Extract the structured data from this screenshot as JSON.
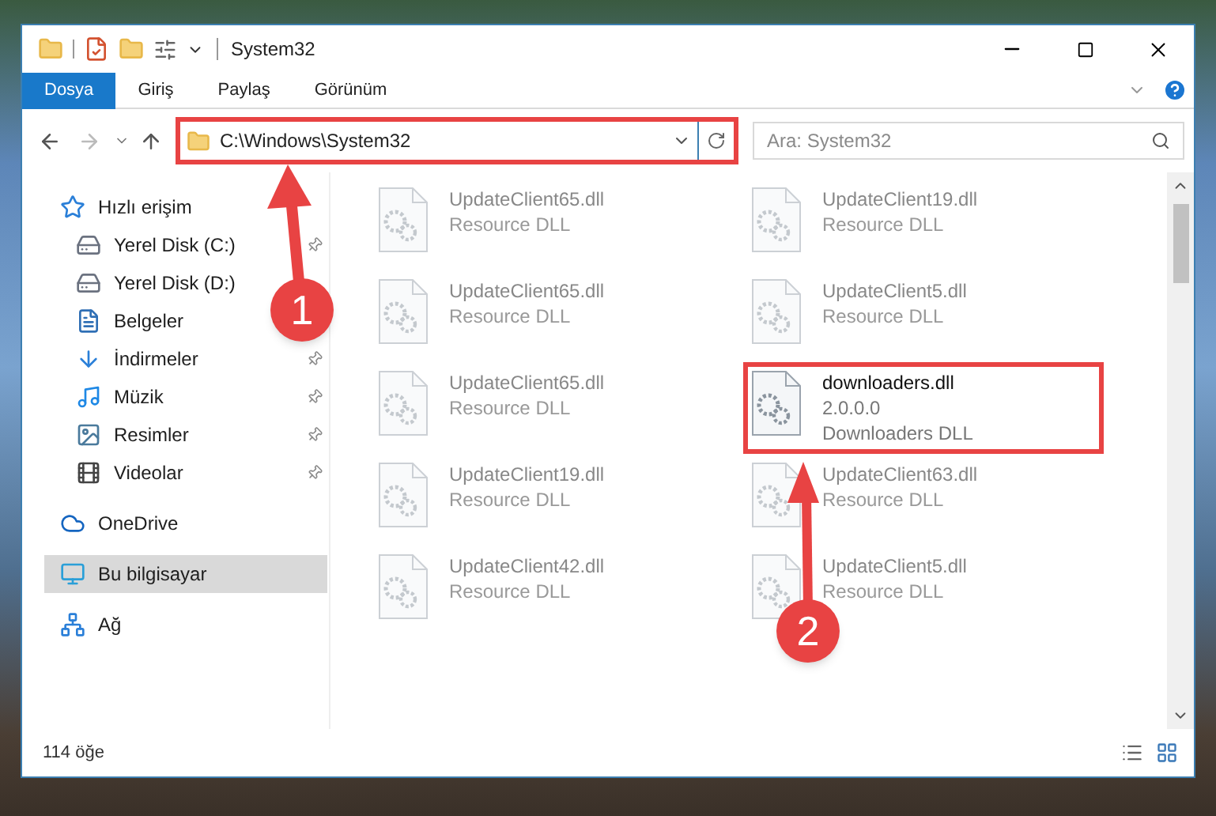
{
  "window": {
    "title": "System32"
  },
  "ribbon_tabs": [
    {
      "label": "Dosya",
      "selected": true
    },
    {
      "label": "Giriş",
      "selected": false
    },
    {
      "label": "Paylaş",
      "selected": false
    },
    {
      "label": "Görünüm",
      "selected": false
    }
  ],
  "address": {
    "path": "C:\\Windows\\System32",
    "annotated": true
  },
  "search": {
    "placeholder": "Ara: System32"
  },
  "sidebar": {
    "items": [
      {
        "label": "Hızlı erişim",
        "selected": false,
        "children": [
          {
            "label": "Yerel Disk (C:)",
            "pinned": true,
            "selected": false
          },
          {
            "label": "Yerel Disk (D:)",
            "selected": false
          },
          {
            "label": "Belgeler",
            "selected": false
          },
          {
            "label": "İndirmeler",
            "pinned": true,
            "selected": false
          },
          {
            "label": "Müzik",
            "pinned": true,
            "selected": false
          },
          {
            "label": "Resimler",
            "pinned": true,
            "selected": false
          },
          {
            "label": "Videolar",
            "pinned": true,
            "selected": false
          }
        ]
      },
      {
        "label": "OneDrive",
        "selected": false
      },
      {
        "label": "Bu bilgisayar",
        "selected": true
      },
      {
        "label": "Ağ",
        "selected": false
      }
    ]
  },
  "files": [
    {
      "name": "UpdateClient65.dll",
      "lines": [
        "Resource DLL"
      ],
      "blurred": true,
      "annotated": false
    },
    {
      "name": "UpdateClient19.dll",
      "lines": [
        "Resource DLL"
      ],
      "blurred": true,
      "annotated": false
    },
    {
      "name": "UpdateClient65.dll",
      "lines": [
        "Resource DLL"
      ],
      "blurred": true,
      "annotated": false
    },
    {
      "name": "UpdateClient5.dll",
      "lines": [
        "Resource DLL"
      ],
      "blurred": true,
      "annotated": false
    },
    {
      "name": "UpdateClient65.dll",
      "lines": [
        "Resource DLL"
      ],
      "blurred": true,
      "annotated": false
    },
    {
      "name": "downloaders.dll",
      "lines": [
        "2.0.0.0",
        "Downloaders DLL"
      ],
      "blurred": false,
      "annotated": true
    },
    {
      "name": "UpdateClient19.dll",
      "lines": [
        "Resource DLL"
      ],
      "blurred": true,
      "annotated": false
    },
    {
      "name": "UpdateClient63.dll",
      "lines": [
        "Resource DLL"
      ],
      "blurred": true,
      "annotated": false
    },
    {
      "name": "UpdateClient42.dll",
      "lines": [
        "Resource DLL"
      ],
      "blurred": true,
      "annotated": false
    },
    {
      "name": "UpdateClient5.dll",
      "lines": [
        "Resource DLL"
      ],
      "blurred": true,
      "annotated": false
    }
  ],
  "status_bar": {
    "count": "114 öğe"
  },
  "annotations": [
    {
      "number": "1"
    },
    {
      "number": "2"
    }
  ]
}
